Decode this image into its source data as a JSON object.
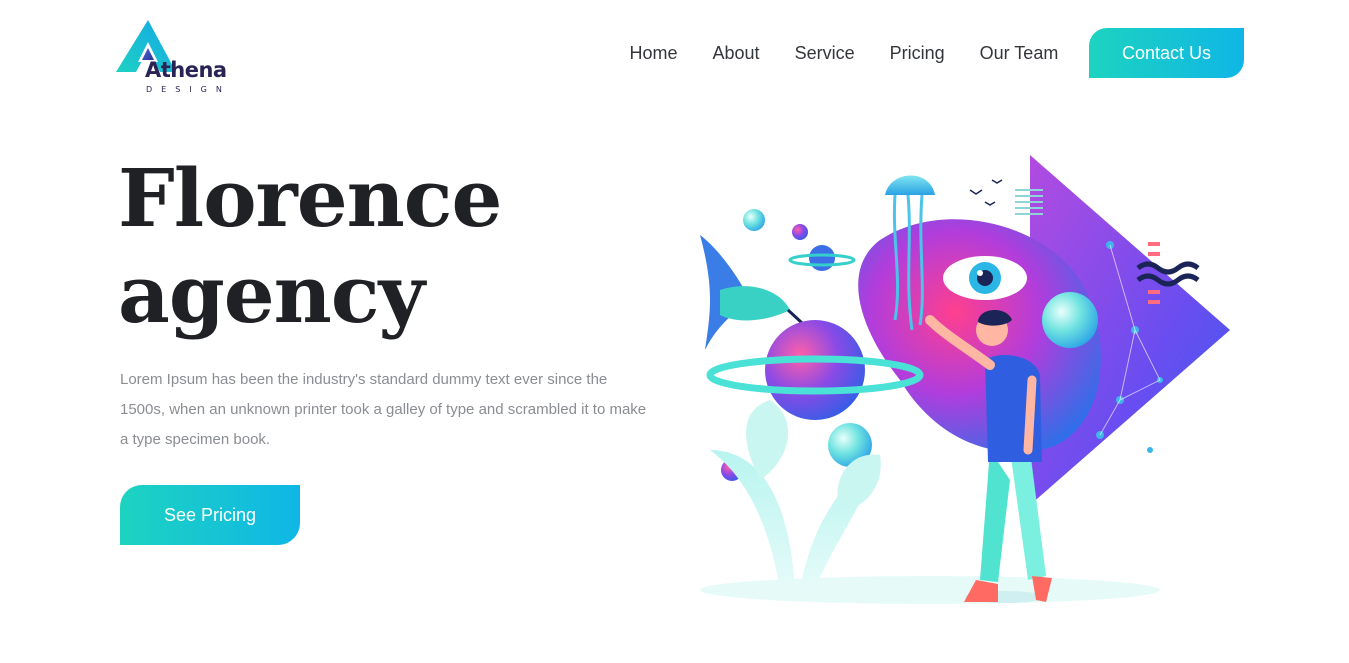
{
  "brand": {
    "name": "Athena",
    "subtitle": "DESIGN"
  },
  "nav": {
    "items": [
      {
        "label": "Home"
      },
      {
        "label": "About"
      },
      {
        "label": "Service"
      },
      {
        "label": "Pricing"
      },
      {
        "label": "Our Team"
      }
    ],
    "contact_label": "Contact Us"
  },
  "hero": {
    "title_line1": "Florence",
    "title_line2": "agency",
    "description": "Lorem Ipsum has been the industry's standard dummy text ever since the 1500s, when an unknown printer took a galley of type and scrambled it to make a type specimen book.",
    "cta_label": "See Pricing"
  },
  "colors": {
    "gradient_start": "#1dd3c0",
    "gradient_end": "#0fb6e6",
    "heading": "#1f2125",
    "body_text": "#8a8d92",
    "nav_text": "#33363b",
    "logo_text": "#2a2356"
  },
  "illustration": {
    "icon": "person-with-surreal-art-illustration"
  }
}
